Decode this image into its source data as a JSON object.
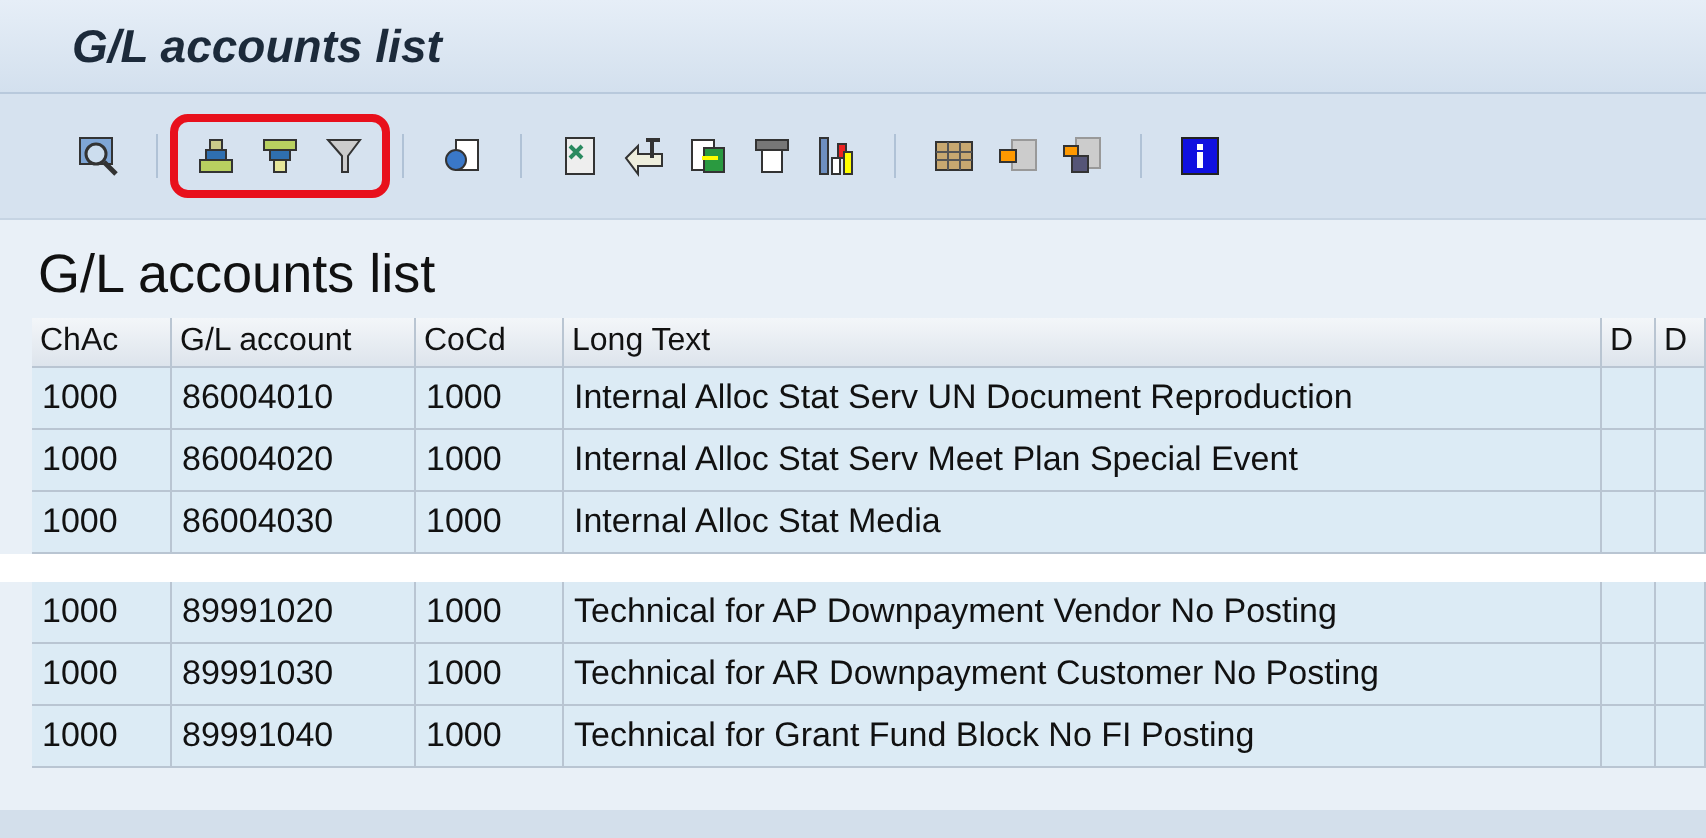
{
  "window": {
    "title": "G/L accounts list"
  },
  "toolbar": {
    "groups": [
      {
        "highlighted": false,
        "icons": [
          {
            "kind": "inspect"
          }
        ]
      },
      {
        "highlighted": true,
        "icons": [
          {
            "kind": "sort_asc"
          },
          {
            "kind": "sort_desc"
          },
          {
            "kind": "filter"
          }
        ]
      },
      {
        "highlighted": false,
        "icons": [
          {
            "kind": "document"
          }
        ]
      },
      {
        "highlighted": false,
        "icons": [
          {
            "kind": "spreadsheet"
          },
          {
            "kind": "text_export"
          },
          {
            "kind": "export"
          },
          {
            "kind": "print"
          },
          {
            "kind": "chart"
          }
        ]
      },
      {
        "highlighted": false,
        "icons": [
          {
            "kind": "layout"
          },
          {
            "kind": "layout_select"
          },
          {
            "kind": "layout_save"
          }
        ]
      },
      {
        "highlighted": false,
        "icons": [
          {
            "kind": "info"
          }
        ]
      }
    ]
  },
  "list": {
    "title": "G/L accounts list",
    "columns": [
      "ChAc",
      "G/L account",
      "CoCd",
      "Long Text",
      "D",
      "D"
    ],
    "row_groups": [
      [
        [
          "1000",
          "86004010",
          "1000",
          "Internal Alloc Stat Serv UN Document Reproduction"
        ],
        [
          "1000",
          "86004020",
          "1000",
          "Internal Alloc Stat Serv Meet Plan Special Event"
        ],
        [
          "1000",
          "86004030",
          "1000",
          "Internal Alloc Stat Media"
        ]
      ],
      [
        [
          "1000",
          "89991020",
          "1000",
          "Technical for AP Downpayment Vendor No Posting"
        ],
        [
          "1000",
          "89991030",
          "1000",
          "Technical for AR Downpayment Customer No Posting"
        ],
        [
          "1000",
          "89991040",
          "1000",
          "Technical for Grant Fund Block No FI Posting"
        ]
      ]
    ]
  }
}
